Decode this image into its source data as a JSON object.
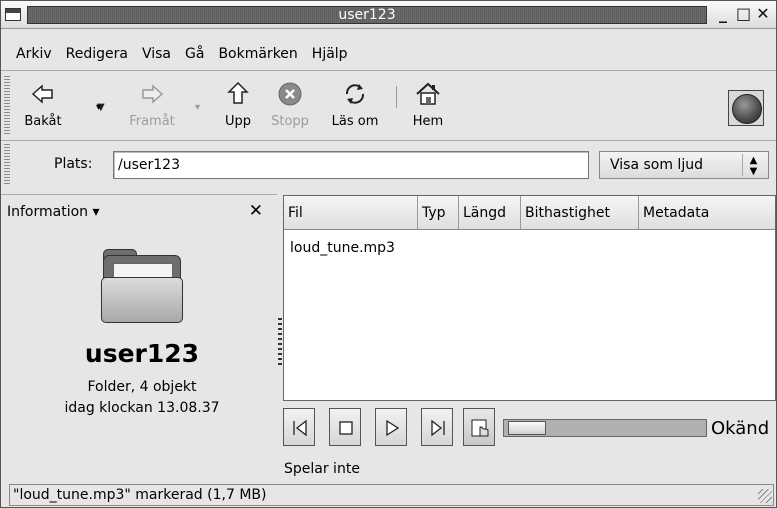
{
  "window": {
    "title": "user123"
  },
  "menubar": {
    "items": [
      {
        "label": "Arkiv"
      },
      {
        "label": "Redigera"
      },
      {
        "label": "Visa"
      },
      {
        "label": "Gå"
      },
      {
        "label": "Bokmärken"
      },
      {
        "label": "Hjälp"
      }
    ]
  },
  "toolbar": {
    "back": {
      "label": "Bakåt",
      "icon": "back-arrow-icon"
    },
    "forward": {
      "label": "Framåt",
      "icon": "forward-arrow-icon"
    },
    "up": {
      "label": "Upp",
      "icon": "up-arrow-icon"
    },
    "stop": {
      "label": "Stopp",
      "icon": "stop-icon"
    },
    "reload": {
      "label": "Läs om",
      "icon": "reload-icon"
    },
    "home": {
      "label": "Hem",
      "icon": "home-icon"
    }
  },
  "location": {
    "label": "Plats:",
    "value": "/user123",
    "view_as": "Visa som ljud"
  },
  "sidepane": {
    "selector": "Information ▾",
    "folder_name": "user123",
    "folder_desc": "Folder, 4 objekt",
    "folder_date": "idag klockan 13.08.37"
  },
  "filelist": {
    "columns": [
      "Fil",
      "Typ",
      "Längd",
      "Bithastighet",
      "Metadata"
    ],
    "rows": [
      {
        "name": "loud_tune.mp3"
      }
    ]
  },
  "player": {
    "length_label": "Okänd",
    "status": "Spelar inte"
  },
  "statusbar": {
    "text": "\"loud_tune.mp3\" markerad (1,7 MB)"
  }
}
